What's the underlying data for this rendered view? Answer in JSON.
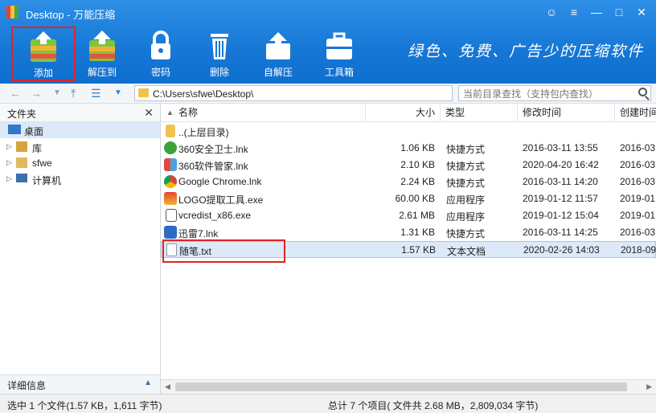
{
  "window": {
    "title": "Desktop - 万能压缩"
  },
  "toolbar": {
    "items": [
      {
        "label": "添加",
        "icon": "add-archive-icon"
      },
      {
        "label": "解压到",
        "icon": "extract-to-icon"
      },
      {
        "label": "密码",
        "icon": "lock-icon"
      },
      {
        "label": "删除",
        "icon": "trash-icon"
      },
      {
        "label": "自解压",
        "icon": "self-extract-icon"
      },
      {
        "label": "工具箱",
        "icon": "toolbox-icon"
      }
    ],
    "slogan": "绿色、免费、广告少的压缩软件"
  },
  "address": {
    "path": "C:\\Users\\sfwe\\Desktop\\"
  },
  "search": {
    "placeholder": "当前目录查找（支持包内查找）"
  },
  "sidebar": {
    "header": "文件夹",
    "tree": [
      {
        "label": "桌面",
        "selected": true
      },
      {
        "label": "库"
      },
      {
        "label": "sfwe"
      },
      {
        "label": "计算机"
      }
    ],
    "details_label": "详细信息"
  },
  "columns": {
    "name": "名称",
    "size": "大小",
    "type": "类型",
    "modified": "修改时间",
    "created": "创建时间"
  },
  "files": [
    {
      "name": "..(上层目录)",
      "size": "",
      "type": "",
      "modified": "",
      "created": "",
      "icon": "folder-up-icon"
    },
    {
      "name": "360安全卫士.lnk",
      "size": "1.06 KB",
      "type": "快捷方式",
      "modified": "2016-03-11 13:55",
      "created": "2016-03",
      "icon": "360-safe-icon"
    },
    {
      "name": "360软件管家.lnk",
      "size": "2.10 KB",
      "type": "快捷方式",
      "modified": "2020-04-20 16:42",
      "created": "2016-03",
      "icon": "360-manager-icon"
    },
    {
      "name": "Google Chrome.lnk",
      "size": "2.24 KB",
      "type": "快捷方式",
      "modified": "2016-03-11 14:20",
      "created": "2016-03",
      "icon": "chrome-icon"
    },
    {
      "name": "LOGO提取工具.exe",
      "size": "60.00 KB",
      "type": "应用程序",
      "modified": "2019-01-12 11:57",
      "created": "2019-01",
      "icon": "logo-tool-icon"
    },
    {
      "name": "vcredist_x86.exe",
      "size": "2.61 MB",
      "type": "应用程序",
      "modified": "2019-01-12 15:04",
      "created": "2019-01",
      "icon": "installer-icon"
    },
    {
      "name": "迅雷7.lnk",
      "size": "1.31 KB",
      "type": "快捷方式",
      "modified": "2016-03-11 14:25",
      "created": "2016-03",
      "icon": "thunder-icon"
    },
    {
      "name": "随笔.txt",
      "size": "1.57 KB",
      "type": "文本文档",
      "modified": "2020-02-26 14:03",
      "created": "2018-09",
      "icon": "text-file-icon",
      "selected": true
    }
  ],
  "status": {
    "left": "选中 1 个文件(1.57 KB，1,611 字节)",
    "right": "总计 7 个项目( 文件共 2.68 MB，2,809,034 字节)"
  }
}
